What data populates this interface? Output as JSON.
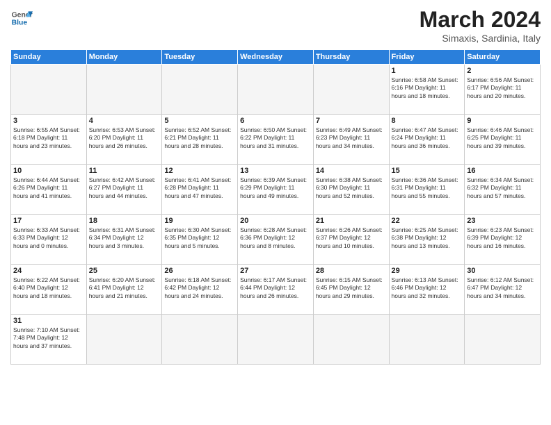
{
  "header": {
    "logo_general": "General",
    "logo_blue": "Blue",
    "month_year": "March 2024",
    "location": "Simaxis, Sardinia, Italy"
  },
  "weekdays": [
    "Sunday",
    "Monday",
    "Tuesday",
    "Wednesday",
    "Thursday",
    "Friday",
    "Saturday"
  ],
  "weeks": [
    [
      {
        "day": "",
        "info": ""
      },
      {
        "day": "",
        "info": ""
      },
      {
        "day": "",
        "info": ""
      },
      {
        "day": "",
        "info": ""
      },
      {
        "day": "",
        "info": ""
      },
      {
        "day": "1",
        "info": "Sunrise: 6:58 AM\nSunset: 6:16 PM\nDaylight: 11 hours\nand 18 minutes."
      },
      {
        "day": "2",
        "info": "Sunrise: 6:56 AM\nSunset: 6:17 PM\nDaylight: 11 hours\nand 20 minutes."
      }
    ],
    [
      {
        "day": "3",
        "info": "Sunrise: 6:55 AM\nSunset: 6:18 PM\nDaylight: 11 hours\nand 23 minutes."
      },
      {
        "day": "4",
        "info": "Sunrise: 6:53 AM\nSunset: 6:20 PM\nDaylight: 11 hours\nand 26 minutes."
      },
      {
        "day": "5",
        "info": "Sunrise: 6:52 AM\nSunset: 6:21 PM\nDaylight: 11 hours\nand 28 minutes."
      },
      {
        "day": "6",
        "info": "Sunrise: 6:50 AM\nSunset: 6:22 PM\nDaylight: 11 hours\nand 31 minutes."
      },
      {
        "day": "7",
        "info": "Sunrise: 6:49 AM\nSunset: 6:23 PM\nDaylight: 11 hours\nand 34 minutes."
      },
      {
        "day": "8",
        "info": "Sunrise: 6:47 AM\nSunset: 6:24 PM\nDaylight: 11 hours\nand 36 minutes."
      },
      {
        "day": "9",
        "info": "Sunrise: 6:46 AM\nSunset: 6:25 PM\nDaylight: 11 hours\nand 39 minutes."
      }
    ],
    [
      {
        "day": "10",
        "info": "Sunrise: 6:44 AM\nSunset: 6:26 PM\nDaylight: 11 hours\nand 41 minutes."
      },
      {
        "day": "11",
        "info": "Sunrise: 6:42 AM\nSunset: 6:27 PM\nDaylight: 11 hours\nand 44 minutes."
      },
      {
        "day": "12",
        "info": "Sunrise: 6:41 AM\nSunset: 6:28 PM\nDaylight: 11 hours\nand 47 minutes."
      },
      {
        "day": "13",
        "info": "Sunrise: 6:39 AM\nSunset: 6:29 PM\nDaylight: 11 hours\nand 49 minutes."
      },
      {
        "day": "14",
        "info": "Sunrise: 6:38 AM\nSunset: 6:30 PM\nDaylight: 11 hours\nand 52 minutes."
      },
      {
        "day": "15",
        "info": "Sunrise: 6:36 AM\nSunset: 6:31 PM\nDaylight: 11 hours\nand 55 minutes."
      },
      {
        "day": "16",
        "info": "Sunrise: 6:34 AM\nSunset: 6:32 PM\nDaylight: 11 hours\nand 57 minutes."
      }
    ],
    [
      {
        "day": "17",
        "info": "Sunrise: 6:33 AM\nSunset: 6:33 PM\nDaylight: 12 hours\nand 0 minutes."
      },
      {
        "day": "18",
        "info": "Sunrise: 6:31 AM\nSunset: 6:34 PM\nDaylight: 12 hours\nand 3 minutes."
      },
      {
        "day": "19",
        "info": "Sunrise: 6:30 AM\nSunset: 6:35 PM\nDaylight: 12 hours\nand 5 minutes."
      },
      {
        "day": "20",
        "info": "Sunrise: 6:28 AM\nSunset: 6:36 PM\nDaylight: 12 hours\nand 8 minutes."
      },
      {
        "day": "21",
        "info": "Sunrise: 6:26 AM\nSunset: 6:37 PM\nDaylight: 12 hours\nand 10 minutes."
      },
      {
        "day": "22",
        "info": "Sunrise: 6:25 AM\nSunset: 6:38 PM\nDaylight: 12 hours\nand 13 minutes."
      },
      {
        "day": "23",
        "info": "Sunrise: 6:23 AM\nSunset: 6:39 PM\nDaylight: 12 hours\nand 16 minutes."
      }
    ],
    [
      {
        "day": "24",
        "info": "Sunrise: 6:22 AM\nSunset: 6:40 PM\nDaylight: 12 hours\nand 18 minutes."
      },
      {
        "day": "25",
        "info": "Sunrise: 6:20 AM\nSunset: 6:41 PM\nDaylight: 12 hours\nand 21 minutes."
      },
      {
        "day": "26",
        "info": "Sunrise: 6:18 AM\nSunset: 6:42 PM\nDaylight: 12 hours\nand 24 minutes."
      },
      {
        "day": "27",
        "info": "Sunrise: 6:17 AM\nSunset: 6:44 PM\nDaylight: 12 hours\nand 26 minutes."
      },
      {
        "day": "28",
        "info": "Sunrise: 6:15 AM\nSunset: 6:45 PM\nDaylight: 12 hours\nand 29 minutes."
      },
      {
        "day": "29",
        "info": "Sunrise: 6:13 AM\nSunset: 6:46 PM\nDaylight: 12 hours\nand 32 minutes."
      },
      {
        "day": "30",
        "info": "Sunrise: 6:12 AM\nSunset: 6:47 PM\nDaylight: 12 hours\nand 34 minutes."
      }
    ],
    [
      {
        "day": "31",
        "info": "Sunrise: 7:10 AM\nSunset: 7:48 PM\nDaylight: 12 hours\nand 37 minutes."
      },
      {
        "day": "",
        "info": ""
      },
      {
        "day": "",
        "info": ""
      },
      {
        "day": "",
        "info": ""
      },
      {
        "day": "",
        "info": ""
      },
      {
        "day": "",
        "info": ""
      },
      {
        "day": "",
        "info": ""
      }
    ]
  ]
}
